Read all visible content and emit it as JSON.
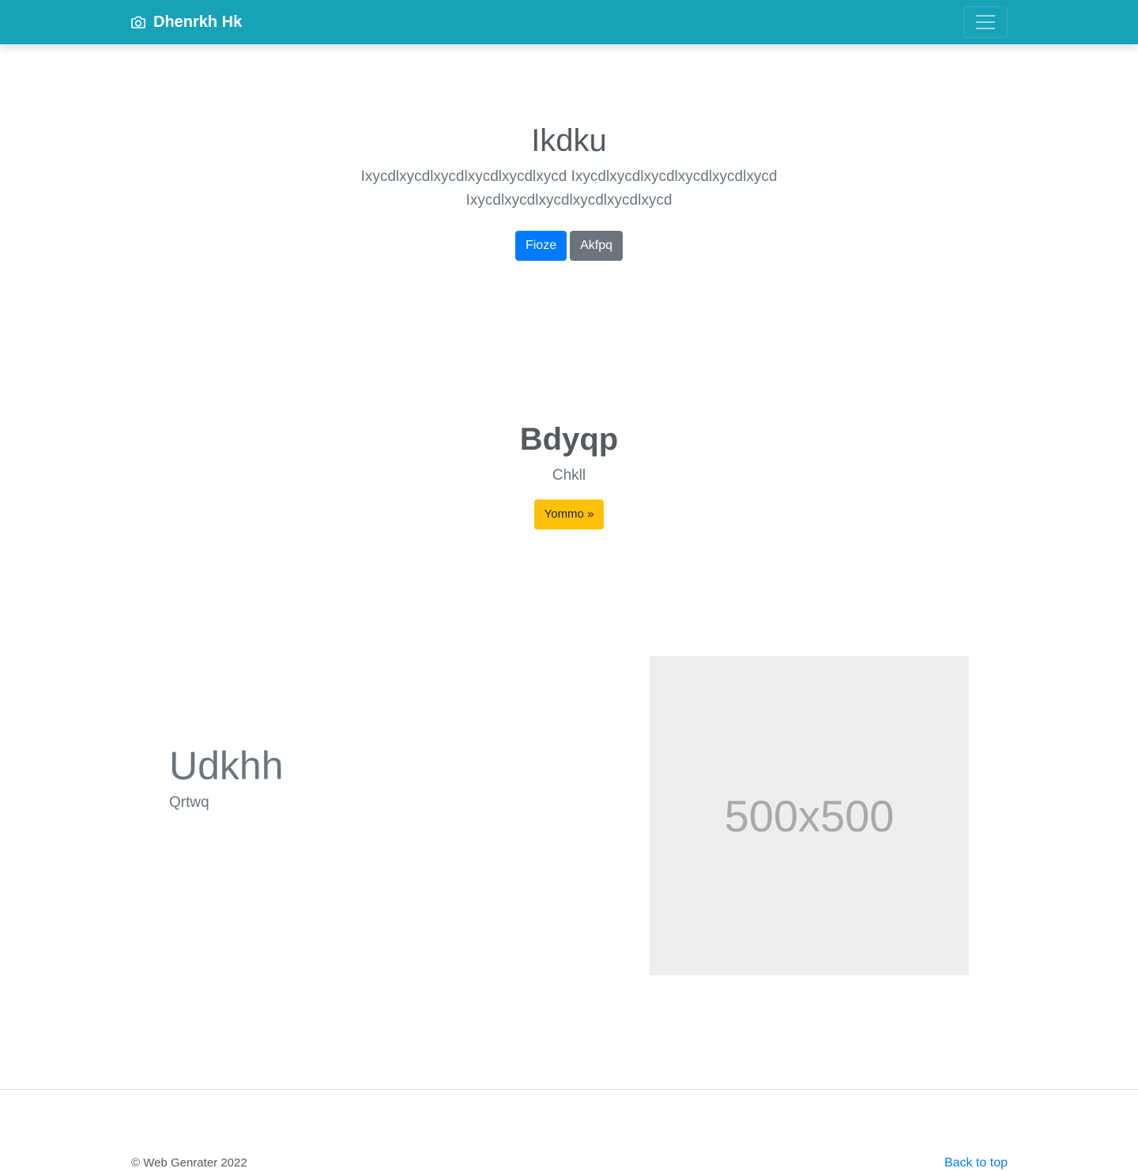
{
  "navbar": {
    "brand_icon": "camera-icon",
    "brand_text": "Dhenrkh Hk",
    "toggler_icon": "hamburger-menu-icon",
    "background_color": "#17a2b8"
  },
  "hero": {
    "title": "Ikdku",
    "lead": "Ixycdlxycdlxycdlxycdlxycdlxycd Ixycdlxycdlxycdlxycdlxycdlxycd Ixycdlxycdlxycdlxycdlxycdlxycd",
    "primary_button": "Fioze",
    "secondary_button": "Akfpq"
  },
  "section2": {
    "title": "Bdyqp",
    "subtitle": "Chkll",
    "button": "Yommo »"
  },
  "feature": {
    "title": "Udkhh",
    "subtitle": "Qrtwq",
    "image_placeholder_text": "500x500"
  },
  "footer": {
    "copyright": "© Web Genrater 2022",
    "back_to_top": "Back to top"
  },
  "colors": {
    "primary": "#007bff",
    "secondary": "#6c757d",
    "warning": "#ffc107",
    "info": "#17a2b8"
  }
}
